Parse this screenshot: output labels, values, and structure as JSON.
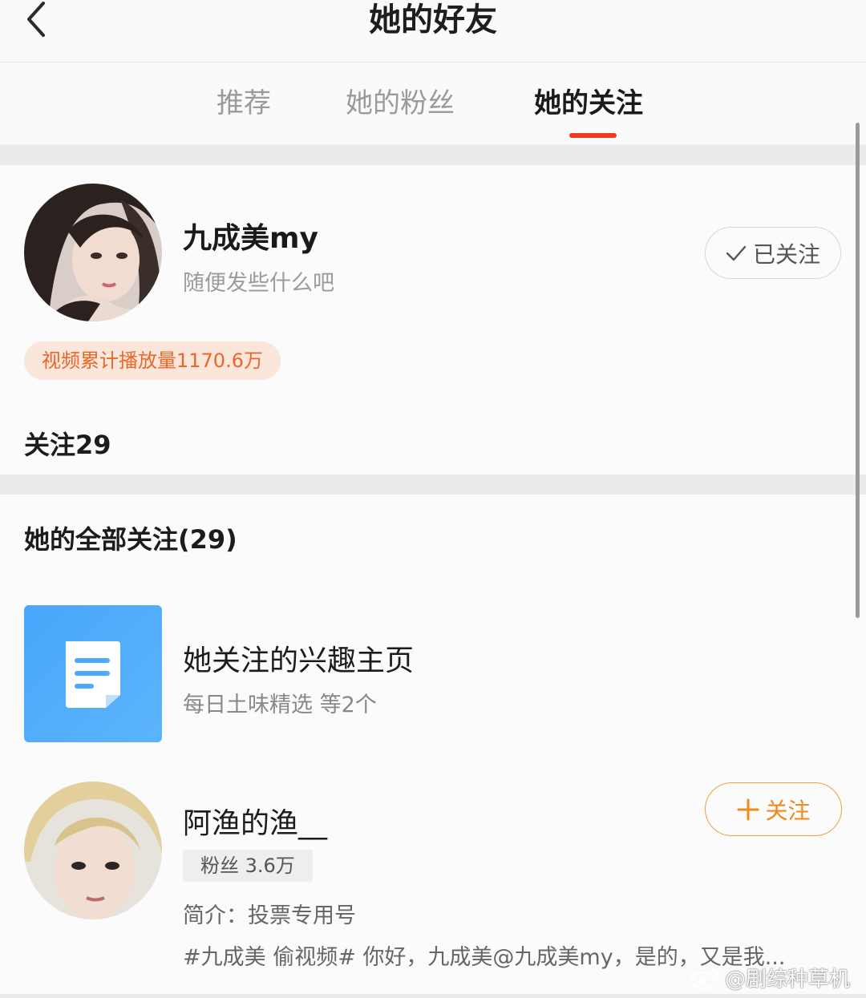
{
  "header": {
    "title": "她的好友"
  },
  "tabs": [
    {
      "label": "推荐"
    },
    {
      "label": "她的粉丝"
    },
    {
      "label": "她的关注",
      "active": true
    }
  ],
  "profile": {
    "name": "九成美my",
    "bio": "随便发些什么吧",
    "follow_state": "已关注",
    "play_badge": "视频累计播放量1170.6万",
    "follow_count": "关注29"
  },
  "list": {
    "title": "她的全部关注(29)",
    "items": [
      {
        "type": "interest",
        "title": "她关注的兴趣主页",
        "subtitle": "每日土味精选 等2个"
      },
      {
        "type": "user",
        "name": "阿渔的渔__",
        "follow_label": "关注",
        "fans": "粉丝 3.6万",
        "intro": "简介：投票专用号",
        "post": "#九成美 偷视频# 你好，九成美@九成美my，是的，又是我..."
      }
    ]
  },
  "watermark": "@剧综种草机",
  "colors": {
    "accent": "#ee3b1f",
    "follow_orange": "#ef8a1c",
    "badge_text": "#e8682a",
    "interest_blue": "#4fa9fb"
  },
  "icons": [
    "chevron-left-icon",
    "check-icon",
    "document-icon",
    "plus-icon",
    "weibo-eye-icon"
  ]
}
